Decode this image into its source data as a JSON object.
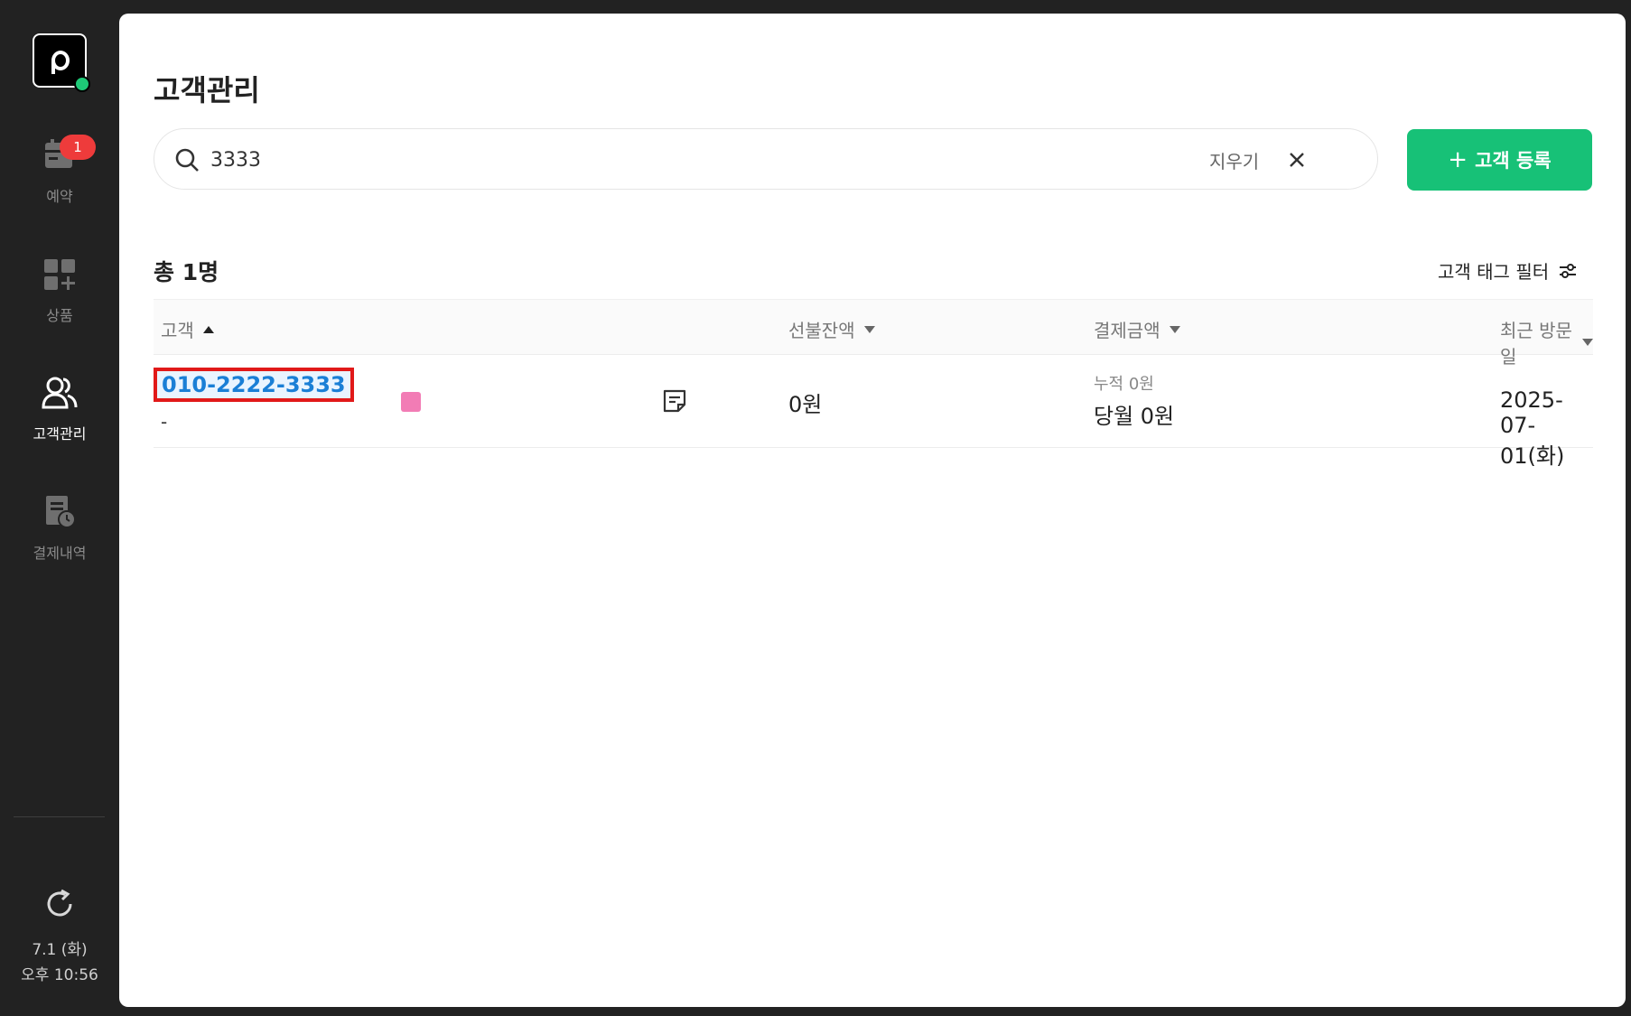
{
  "sidebar": {
    "items": [
      {
        "label": "예약",
        "badge": "1"
      },
      {
        "label": "상품"
      },
      {
        "label": "고객관리"
      },
      {
        "label": "결제내역"
      }
    ],
    "date": "7.1 (화)",
    "time": "오후 10:56"
  },
  "page": {
    "title": "고객관리"
  },
  "search": {
    "value": "3333",
    "clear_label": "지우기"
  },
  "add_button": {
    "plus": "+",
    "label": "고객 등록"
  },
  "list": {
    "total": "총 1명",
    "tag_filter_label": "고객 태그 필터",
    "columns": [
      "고객",
      "선불잔액",
      "결제금액",
      "최근 방문일"
    ],
    "rows": [
      {
        "phone": "010-2222-3333",
        "name": "-",
        "tag_color": "#f27cb5",
        "prepaid": "0원",
        "payment_cumulative": "누적 0원",
        "payment_month": "당월 0원",
        "last_visit": "2025-07-01(화)"
      }
    ]
  },
  "colors": {
    "accent": "#17c177",
    "badge": "#ee3b3b",
    "highlight_border": "#e11919",
    "link": "#1a7fd6"
  }
}
